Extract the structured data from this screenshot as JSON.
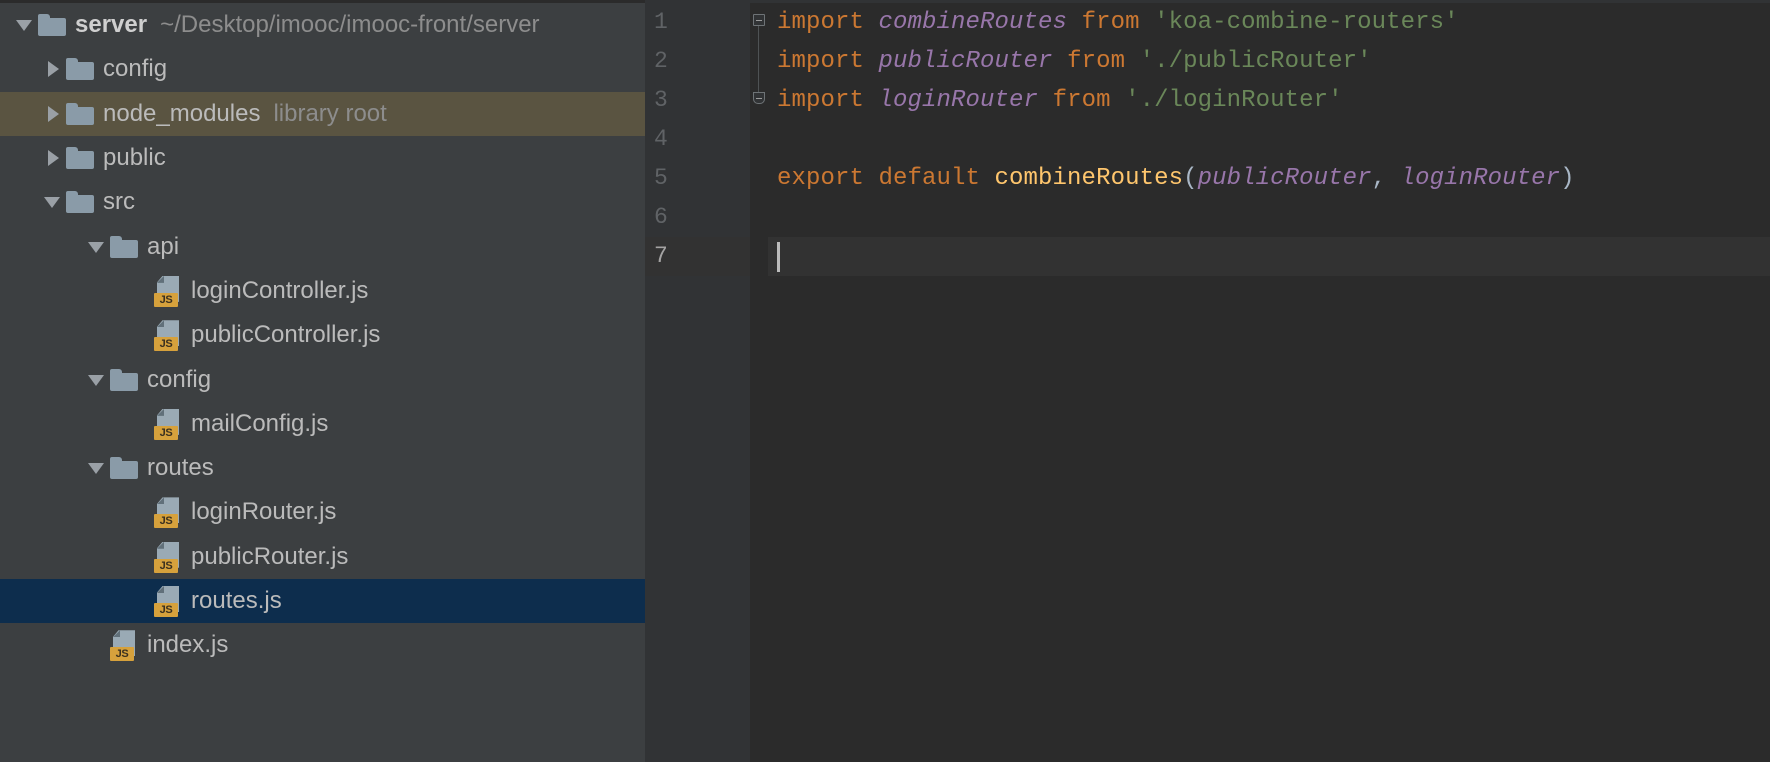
{
  "window": {
    "theme": "darcula",
    "colors": {
      "sidebar_bg": "#3c3f41",
      "editor_bg": "#2b2b2b",
      "gutter_bg": "#313335",
      "selection_blue": "#0d2d4d",
      "selection_olive": "#5a5441",
      "current_line": "#323232",
      "keyword": "#cc7832",
      "identifier": "#9876aa",
      "string": "#6a8759",
      "function": "#ffc66d",
      "punctuation": "#a9b7c6",
      "text": "#bbbbbb"
    }
  },
  "project_tree": {
    "rows": [
      {
        "label": "server",
        "hint": "~/Desktop/imooc/imooc-front/server",
        "icon": "folder-icon",
        "arrow": "down",
        "depth": 0,
        "bold": true,
        "state": "normal"
      },
      {
        "label": "config",
        "hint": "",
        "icon": "folder-icon",
        "arrow": "right",
        "depth": 1,
        "bold": false,
        "state": "normal"
      },
      {
        "label": "node_modules",
        "hint": "library root",
        "icon": "folder-icon",
        "arrow": "right",
        "depth": 1,
        "bold": false,
        "state": "olive"
      },
      {
        "label": "public",
        "hint": "",
        "icon": "folder-icon",
        "arrow": "right",
        "depth": 1,
        "bold": false,
        "state": "normal"
      },
      {
        "label": "src",
        "hint": "",
        "icon": "folder-icon",
        "arrow": "down",
        "depth": 1,
        "bold": false,
        "state": "normal"
      },
      {
        "label": "api",
        "hint": "",
        "icon": "folder-icon",
        "arrow": "down",
        "depth": 2,
        "bold": false,
        "state": "normal"
      },
      {
        "label": "loginController.js",
        "hint": "",
        "icon": "js-file-icon",
        "arrow": "none",
        "depth": 3,
        "bold": false,
        "state": "normal"
      },
      {
        "label": "publicController.js",
        "hint": "",
        "icon": "js-file-icon",
        "arrow": "none",
        "depth": 3,
        "bold": false,
        "state": "normal"
      },
      {
        "label": "config",
        "hint": "",
        "icon": "folder-icon",
        "arrow": "down",
        "depth": 2,
        "bold": false,
        "state": "normal"
      },
      {
        "label": "mailConfig.js",
        "hint": "",
        "icon": "js-file-icon",
        "arrow": "none",
        "depth": 3,
        "bold": false,
        "state": "normal"
      },
      {
        "label": "routes",
        "hint": "",
        "icon": "folder-icon",
        "arrow": "down",
        "depth": 2,
        "bold": false,
        "state": "normal"
      },
      {
        "label": "loginRouter.js",
        "hint": "",
        "icon": "js-file-icon",
        "arrow": "none",
        "depth": 3,
        "bold": false,
        "state": "normal"
      },
      {
        "label": "publicRouter.js",
        "hint": "",
        "icon": "js-file-icon",
        "arrow": "none",
        "depth": 3,
        "bold": false,
        "state": "normal"
      },
      {
        "label": "routes.js",
        "hint": "",
        "icon": "js-file-icon",
        "arrow": "none",
        "depth": 3,
        "bold": false,
        "state": "selected"
      },
      {
        "label": "index.js",
        "hint": "",
        "icon": "js-file-icon",
        "arrow": "none",
        "depth": 2,
        "bold": false,
        "state": "normal"
      }
    ],
    "js_badge_text": "JS"
  },
  "editor": {
    "current_line": 7,
    "lines": [
      {
        "number": "1",
        "fold": "start",
        "tokens": [
          {
            "t": "import ",
            "c": "kw"
          },
          {
            "t": "combineRoutes",
            "c": "id"
          },
          {
            "t": " from ",
            "c": "kw"
          },
          {
            "t": "'koa-combine-routers'",
            "c": "str"
          }
        ]
      },
      {
        "number": "2",
        "fold": "middle",
        "tokens": [
          {
            "t": "import ",
            "c": "kw"
          },
          {
            "t": "publicRouter",
            "c": "id"
          },
          {
            "t": " from ",
            "c": "kw"
          },
          {
            "t": "'./publicRouter'",
            "c": "str"
          }
        ]
      },
      {
        "number": "3",
        "fold": "end",
        "tokens": [
          {
            "t": "import ",
            "c": "kw"
          },
          {
            "t": "loginRouter",
            "c": "id"
          },
          {
            "t": " from ",
            "c": "kw"
          },
          {
            "t": "'./loginRouter'",
            "c": "str"
          }
        ]
      },
      {
        "number": "4",
        "fold": "none",
        "tokens": []
      },
      {
        "number": "5",
        "fold": "none",
        "tokens": [
          {
            "t": "export default ",
            "c": "kw"
          },
          {
            "t": "combineRoutes",
            "c": "fn"
          },
          {
            "t": "(",
            "c": "punc"
          },
          {
            "t": "publicRouter",
            "c": "id"
          },
          {
            "t": ", ",
            "c": "punc"
          },
          {
            "t": "loginRouter",
            "c": "id"
          },
          {
            "t": ")",
            "c": "punc"
          }
        ]
      },
      {
        "number": "6",
        "fold": "none",
        "tokens": []
      },
      {
        "number": "7",
        "fold": "none",
        "tokens": []
      }
    ]
  }
}
